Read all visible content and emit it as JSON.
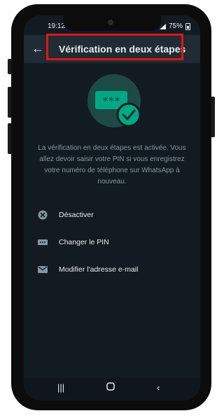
{
  "status_bar": {
    "time": "19:12",
    "battery": "75%"
  },
  "header": {
    "title": "Vérification en deux étapes"
  },
  "description": "La vérification en deux étapes est activée. Vous allez devoir saisir votre PIN si vous enregistrez votre numéro de téléphone sur WhatsApp à nouveau.",
  "illustration": {
    "pin_mask": "***"
  },
  "options": [
    {
      "label": "Désactiver",
      "icon": "x-circle-icon"
    },
    {
      "label": "Changer le PIN",
      "icon": "pin-dots-icon"
    },
    {
      "label": "Modifier l'adresse e-mail",
      "icon": "email-icon"
    }
  ],
  "colors": {
    "background": "#111b21",
    "header_bg": "#1f2c34",
    "accent": "#00a884",
    "highlight": "#e31414"
  }
}
